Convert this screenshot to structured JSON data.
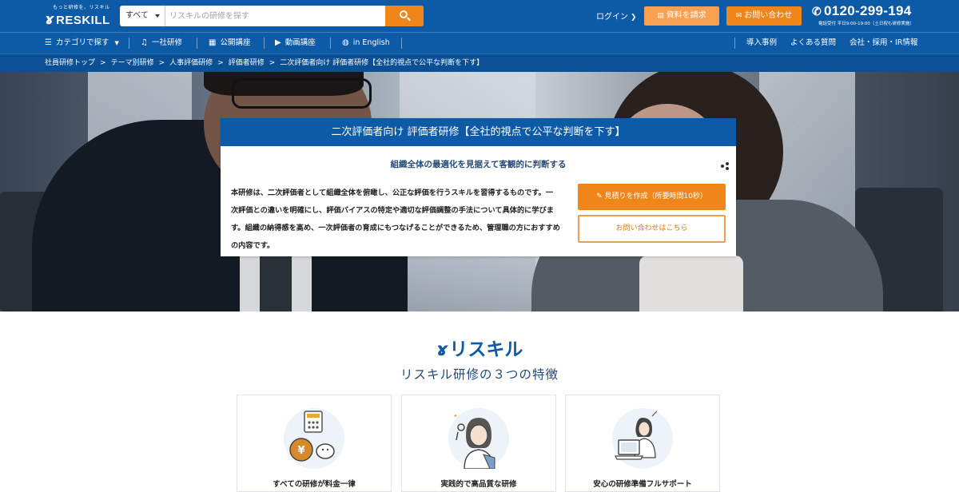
{
  "header": {
    "logo_tagline": "もっと研修を、リスキル",
    "logo_name": "RESKILL",
    "search_scope": "すべて",
    "search_placeholder": "リスキルの研修を探す",
    "login": "ログイン",
    "request_docs": "資料を請求",
    "contact": "お問い合わせ",
    "phone": "0120-299-194",
    "phone_hours": "電話受付 平日9:00-19:00（土日祝も研修実施）"
  },
  "nav": {
    "category": "カテゴリで探す",
    "in_house": "一社研修",
    "public": "公開講座",
    "video": "動画講座",
    "english": "in English",
    "cases": "導入事例",
    "faq": "よくある質問",
    "company": "会社・採用・IR情報"
  },
  "breadcrumb": [
    "社員研修トップ",
    "テーマ別研修",
    "人事評価研修",
    "評価者研修",
    "二次評価者向け 評価者研修【全社的視点で公平な判断を下す】"
  ],
  "course": {
    "title": "二次評価者向け 評価者研修【全社的視点で公平な判断を下す】",
    "subtitle": "組織全体の最適化を見据えて客観的に判断する",
    "description": "本研修は、二次評価者として組織全体を俯瞰し、公正な評価を行うスキルを習得するものです。一次評価との違いを明確にし、評価バイアスの特定や適切な評価調整の手法について具体的に学びます。組織の納得感を高め、一次評価者の育成にもつなげることができるため、管理職の方におすすめの内容です。",
    "quote_button": "見積りを作成（所要時間10秒）",
    "contact_button": "お問い合わせはこちら"
  },
  "features": {
    "brand": "リスキル",
    "heading": "リスキル研修の３つの特徴",
    "items": [
      {
        "label": "すべての研修が料金一律"
      },
      {
        "label": "実践的で高品質な研修"
      },
      {
        "label": "安心の研修準備フルサポート"
      }
    ]
  },
  "colors": {
    "primary": "#0d5aa7",
    "accent": "#f08519"
  }
}
